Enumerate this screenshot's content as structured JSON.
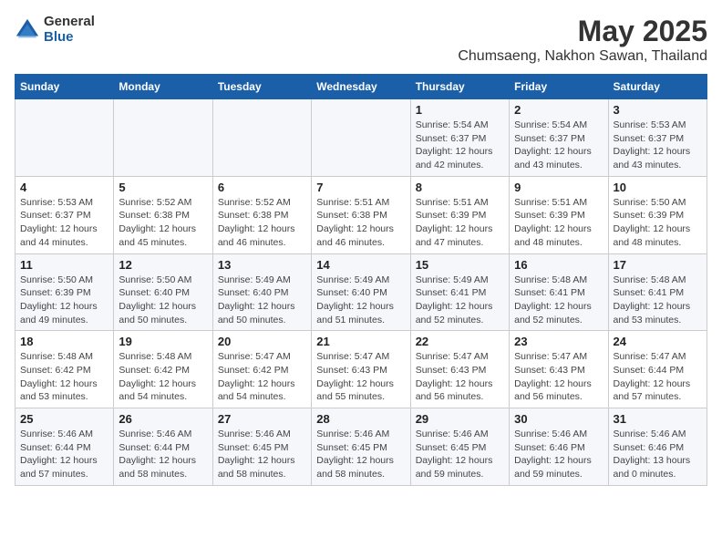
{
  "logo": {
    "general": "General",
    "blue": "Blue"
  },
  "title": "May 2025",
  "subtitle": "Chumsaeng, Nakhon Sawan, Thailand",
  "days_of_week": [
    "Sunday",
    "Monday",
    "Tuesday",
    "Wednesday",
    "Thursday",
    "Friday",
    "Saturday"
  ],
  "weeks": [
    [
      {
        "day": "",
        "info": ""
      },
      {
        "day": "",
        "info": ""
      },
      {
        "day": "",
        "info": ""
      },
      {
        "day": "",
        "info": ""
      },
      {
        "day": "1",
        "info": "Sunrise: 5:54 AM\nSunset: 6:37 PM\nDaylight: 12 hours\nand 42 minutes."
      },
      {
        "day": "2",
        "info": "Sunrise: 5:54 AM\nSunset: 6:37 PM\nDaylight: 12 hours\nand 43 minutes."
      },
      {
        "day": "3",
        "info": "Sunrise: 5:53 AM\nSunset: 6:37 PM\nDaylight: 12 hours\nand 43 minutes."
      }
    ],
    [
      {
        "day": "4",
        "info": "Sunrise: 5:53 AM\nSunset: 6:37 PM\nDaylight: 12 hours\nand 44 minutes."
      },
      {
        "day": "5",
        "info": "Sunrise: 5:52 AM\nSunset: 6:38 PM\nDaylight: 12 hours\nand 45 minutes."
      },
      {
        "day": "6",
        "info": "Sunrise: 5:52 AM\nSunset: 6:38 PM\nDaylight: 12 hours\nand 46 minutes."
      },
      {
        "day": "7",
        "info": "Sunrise: 5:51 AM\nSunset: 6:38 PM\nDaylight: 12 hours\nand 46 minutes."
      },
      {
        "day": "8",
        "info": "Sunrise: 5:51 AM\nSunset: 6:39 PM\nDaylight: 12 hours\nand 47 minutes."
      },
      {
        "day": "9",
        "info": "Sunrise: 5:51 AM\nSunset: 6:39 PM\nDaylight: 12 hours\nand 48 minutes."
      },
      {
        "day": "10",
        "info": "Sunrise: 5:50 AM\nSunset: 6:39 PM\nDaylight: 12 hours\nand 48 minutes."
      }
    ],
    [
      {
        "day": "11",
        "info": "Sunrise: 5:50 AM\nSunset: 6:39 PM\nDaylight: 12 hours\nand 49 minutes."
      },
      {
        "day": "12",
        "info": "Sunrise: 5:50 AM\nSunset: 6:40 PM\nDaylight: 12 hours\nand 50 minutes."
      },
      {
        "day": "13",
        "info": "Sunrise: 5:49 AM\nSunset: 6:40 PM\nDaylight: 12 hours\nand 50 minutes."
      },
      {
        "day": "14",
        "info": "Sunrise: 5:49 AM\nSunset: 6:40 PM\nDaylight: 12 hours\nand 51 minutes."
      },
      {
        "day": "15",
        "info": "Sunrise: 5:49 AM\nSunset: 6:41 PM\nDaylight: 12 hours\nand 52 minutes."
      },
      {
        "day": "16",
        "info": "Sunrise: 5:48 AM\nSunset: 6:41 PM\nDaylight: 12 hours\nand 52 minutes."
      },
      {
        "day": "17",
        "info": "Sunrise: 5:48 AM\nSunset: 6:41 PM\nDaylight: 12 hours\nand 53 minutes."
      }
    ],
    [
      {
        "day": "18",
        "info": "Sunrise: 5:48 AM\nSunset: 6:42 PM\nDaylight: 12 hours\nand 53 minutes."
      },
      {
        "day": "19",
        "info": "Sunrise: 5:48 AM\nSunset: 6:42 PM\nDaylight: 12 hours\nand 54 minutes."
      },
      {
        "day": "20",
        "info": "Sunrise: 5:47 AM\nSunset: 6:42 PM\nDaylight: 12 hours\nand 54 minutes."
      },
      {
        "day": "21",
        "info": "Sunrise: 5:47 AM\nSunset: 6:43 PM\nDaylight: 12 hours\nand 55 minutes."
      },
      {
        "day": "22",
        "info": "Sunrise: 5:47 AM\nSunset: 6:43 PM\nDaylight: 12 hours\nand 56 minutes."
      },
      {
        "day": "23",
        "info": "Sunrise: 5:47 AM\nSunset: 6:43 PM\nDaylight: 12 hours\nand 56 minutes."
      },
      {
        "day": "24",
        "info": "Sunrise: 5:47 AM\nSunset: 6:44 PM\nDaylight: 12 hours\nand 57 minutes."
      }
    ],
    [
      {
        "day": "25",
        "info": "Sunrise: 5:46 AM\nSunset: 6:44 PM\nDaylight: 12 hours\nand 57 minutes."
      },
      {
        "day": "26",
        "info": "Sunrise: 5:46 AM\nSunset: 6:44 PM\nDaylight: 12 hours\nand 58 minutes."
      },
      {
        "day": "27",
        "info": "Sunrise: 5:46 AM\nSunset: 6:45 PM\nDaylight: 12 hours\nand 58 minutes."
      },
      {
        "day": "28",
        "info": "Sunrise: 5:46 AM\nSunset: 6:45 PM\nDaylight: 12 hours\nand 58 minutes."
      },
      {
        "day": "29",
        "info": "Sunrise: 5:46 AM\nSunset: 6:45 PM\nDaylight: 12 hours\nand 59 minutes."
      },
      {
        "day": "30",
        "info": "Sunrise: 5:46 AM\nSunset: 6:46 PM\nDaylight: 12 hours\nand 59 minutes."
      },
      {
        "day": "31",
        "info": "Sunrise: 5:46 AM\nSunset: 6:46 PM\nDaylight: 13 hours\nand 0 minutes."
      }
    ]
  ]
}
